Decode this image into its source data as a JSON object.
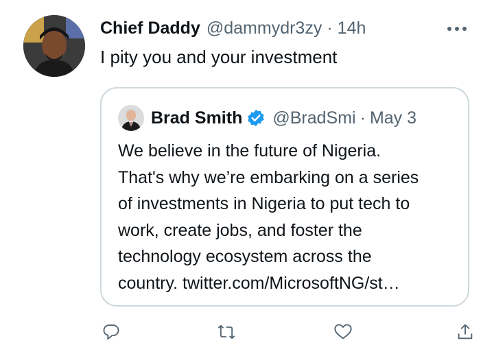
{
  "tweet": {
    "author_name": "Chief Daddy",
    "author_handle": "@dammydr3zy",
    "separator": "·",
    "time": "14h",
    "text": "I pity you and your investment"
  },
  "quoted_tweet": {
    "author_name": "Brad Smith",
    "author_handle": "@BradSmi",
    "separator": "·",
    "date": "May 3",
    "text_lines": [
      "We believe in the future of Nigeria.",
      "That's why we’re embarking on a series",
      "of investments in Nigeria to put tech to",
      "work, create jobs, and foster the",
      "technology ecosystem across the",
      "country. twitter.com/MicrosoftNG/st…"
    ]
  },
  "icons": {
    "more": "more-horizontal-icon",
    "verified": "verified-badge-icon",
    "actions": [
      "reply-icon",
      "retweet-icon",
      "like-icon",
      "share-icon"
    ]
  },
  "colors": {
    "primary_text": "#0f1419",
    "secondary_text": "#536471",
    "border": "#cfd9de",
    "verified_blue": "#1d9bf0"
  }
}
